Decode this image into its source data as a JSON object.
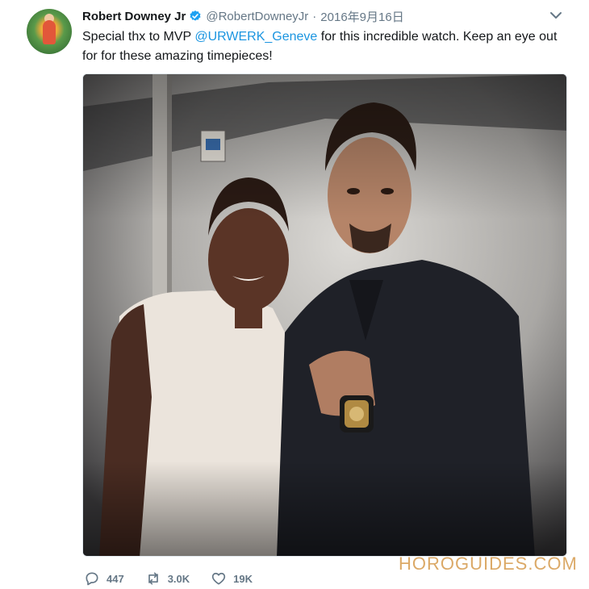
{
  "tweet": {
    "author_name": "Robert Downey Jr",
    "handle": "@RobertDowneyJr",
    "separator": "·",
    "date": "2016年9月16日",
    "text_before": "Special thx to MVP ",
    "mention": "@URWERK_Geneve",
    "text_after": " for this incredible watch. Keep an eye out for for these amazing timepieces!",
    "icons": {
      "verified": "verified-badge-icon",
      "menu": "chevron-down-icon",
      "reply": "reply-icon",
      "retweet": "retweet-icon",
      "like": "heart-icon"
    }
  },
  "stats": {
    "replies": "447",
    "retweets": "3.0K",
    "likes": "19K"
  },
  "watermark": "HOROGUIDES.COM",
  "colors": {
    "link": "#1b95e0",
    "muted": "#657786",
    "verified": "#1da1f2",
    "watermark": "#d9a25b"
  }
}
